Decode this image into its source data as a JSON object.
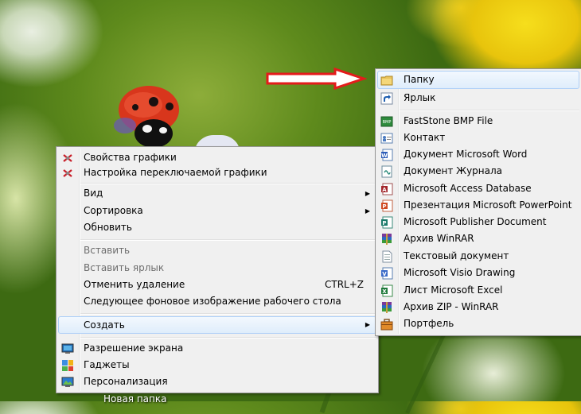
{
  "desktop": {
    "folder_caption": "Новая папка"
  },
  "context_menu": {
    "items": [
      {
        "label": "Свойства графики",
        "icon": "graphics-properties-icon"
      },
      {
        "label": "Настройка переключаемой графики",
        "icon": "switchable-graphics-icon"
      },
      {
        "label": "Вид"
      },
      {
        "label": "Сортировка"
      },
      {
        "label": "Обновить"
      },
      {
        "label": "Вставить",
        "disabled": true
      },
      {
        "label": "Вставить ярлык",
        "disabled": true
      },
      {
        "label": "Отменить удаление",
        "shortcut": "CTRL+Z"
      },
      {
        "label": "Следующее фоновое изображение рабочего стола"
      },
      {
        "label": "Создать",
        "highlighted": true
      },
      {
        "label": "Разрешение экрана",
        "icon": "screen-resolution-icon"
      },
      {
        "label": "Гаджеты",
        "icon": "gadgets-icon"
      },
      {
        "label": "Персонализация",
        "icon": "personalization-icon"
      }
    ]
  },
  "create_submenu": {
    "items": [
      {
        "label": "Папку",
        "icon": "folder-icon",
        "highlighted": true
      },
      {
        "label": "Ярлык",
        "icon": "shortcut-icon"
      },
      {
        "label": "FastStone BMP File",
        "icon": "bmp-file-icon"
      },
      {
        "label": "Контакт",
        "icon": "contact-icon"
      },
      {
        "label": "Документ Microsoft Word",
        "icon": "word-icon"
      },
      {
        "label": "Документ Журнала",
        "icon": "journal-icon"
      },
      {
        "label": "Microsoft Access Database",
        "icon": "access-icon"
      },
      {
        "label": "Презентация Microsoft PowerPoint",
        "icon": "powerpoint-icon"
      },
      {
        "label": "Microsoft Publisher Document",
        "icon": "publisher-icon"
      },
      {
        "label": "Архив WinRAR",
        "icon": "winrar-icon"
      },
      {
        "label": "Текстовый документ",
        "icon": "text-document-icon"
      },
      {
        "label": "Microsoft Visio Drawing",
        "icon": "visio-icon"
      },
      {
        "label": "Лист Microsoft Excel",
        "icon": "excel-icon"
      },
      {
        "label": "Архив ZIP - WinRAR",
        "icon": "zip-archive-icon"
      },
      {
        "label": "Портфель",
        "icon": "briefcase-icon"
      }
    ]
  },
  "colors": {
    "highlight_border": "#aecff7",
    "arrow": "#e41b1b"
  }
}
